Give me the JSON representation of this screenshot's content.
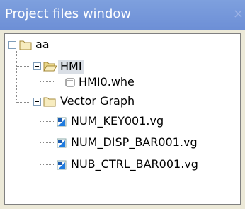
{
  "panel": {
    "title": "Project files window",
    "close_glyph": "×"
  },
  "tree": {
    "root": {
      "label": "aa",
      "icon": "folder-icon"
    },
    "hmi": {
      "label": "HMI",
      "icon": "folder-open-icon"
    },
    "hmi_file": {
      "label": "HMI0.whe",
      "icon": "file-icon"
    },
    "vector": {
      "label": "Vector Graph",
      "icon": "folder-icon"
    },
    "vg_files": [
      {
        "label": "NUM_KEY001.vg",
        "icon": "vector-file-icon"
      },
      {
        "label": "NUM_DISP_BAR001.vg",
        "icon": "vector-file-icon"
      },
      {
        "label": "NUB_CTRL_BAR001.vg",
        "icon": "vector-file-icon"
      }
    ]
  },
  "colors": {
    "title_bg": "#7ea0de",
    "selection_bg": "#dadfe6",
    "folder_fill": "#f7ecbf",
    "vector_file_blue": "#1f7be0"
  }
}
